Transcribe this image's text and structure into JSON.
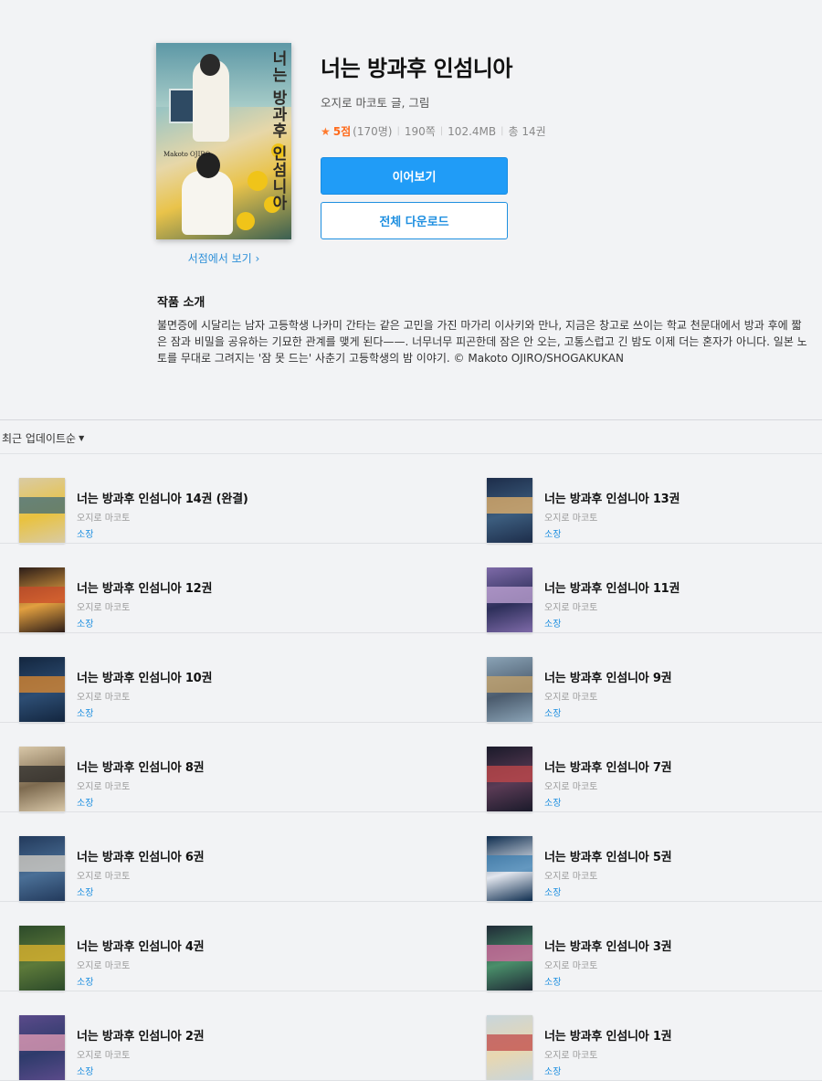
{
  "book": {
    "title": "너는 방과후 인섬니아",
    "author_line": "오지로 마코토 글, 그림",
    "rating": "5점",
    "rating_count": "(170명)",
    "pages": "190쪽",
    "size": "102.4MB",
    "volumes": "총 14권",
    "cover_title": "너는 방과후 인섬니아",
    "cover_author": "Makoto OJIRO",
    "store_link": "서점에서 보기 ›"
  },
  "actions": {
    "continue_label": "이어보기",
    "download_all_label": "전체 다운로드"
  },
  "intro": {
    "heading": "작품 소개",
    "text": "불면증에 시달리는 남자 고등학생 나카미 간타는 같은 고민을 가진 마가리 이사키와 만나, 지금은 창고로 쓰이는 학교 천문대에서 방과 후에 짧은 잠과 비밀을 공유하는 기묘한 관계를 맺게 된다——. 너무너무 피곤한데 잠은 안 오는, 고통스럽고 긴 밤도 이제 더는 혼자가 아니다. 일본 노토를 무대로 그려지는 '잠 못 드는' 사춘기 고등학생의 밤 이야기. © Makoto OJIRO/SHOGAKUKAN"
  },
  "sort": {
    "label": "최근 업데이트순"
  },
  "volumes": [
    {
      "title": "너는 방과후 인섬니아 14권 (완결)",
      "author": "오지로 마코토",
      "status": "소장",
      "colors": [
        "#d9cba4",
        "#3f6b7a",
        "#e9c23f"
      ]
    },
    {
      "title": "너는 방과후 인섬니아 13권",
      "author": "오지로 마코토",
      "status": "소장",
      "colors": [
        "#1d2d4a",
        "#e8b36a",
        "#3c5d7e"
      ]
    },
    {
      "title": "너는 방과후 인섬니아 12권",
      "author": "오지로 마코토",
      "status": "소장",
      "colors": [
        "#2c1d18",
        "#c94a2a",
        "#e2a040"
      ]
    },
    {
      "title": "너는 방과후 인섬니아 11권",
      "author": "오지로 마코토",
      "status": "소장",
      "colors": [
        "#7e6aa8",
        "#c4a7d8",
        "#2d2f5a"
      ]
    },
    {
      "title": "너는 방과후 인섬니아 10권",
      "author": "오지로 마코토",
      "status": "소장",
      "colors": [
        "#13263f",
        "#e08a2e",
        "#2d4d73"
      ]
    },
    {
      "title": "너는 방과후 인섬니아 9권",
      "author": "오지로 마코토",
      "status": "소장",
      "colors": [
        "#8aa3b6",
        "#c9a56b",
        "#4b5b6d"
      ]
    },
    {
      "title": "너는 방과후 인섬니아 8권",
      "author": "오지로 마코토",
      "status": "소장",
      "colors": [
        "#d8c7a8",
        "#2a2a2a",
        "#7d6a4f"
      ]
    },
    {
      "title": "너는 방과후 인섬니아 7권",
      "author": "오지로 마코토",
      "status": "소장",
      "colors": [
        "#1a1a2a",
        "#c4484a",
        "#5a3b55"
      ]
    },
    {
      "title": "너는 방과후 인섬니아 6권",
      "author": "오지로 마코토",
      "status": "소장",
      "colors": [
        "#233a5c",
        "#d9d2c6",
        "#4a6f96"
      ]
    },
    {
      "title": "너는 방과후 인섬니아 5권",
      "author": "오지로 마코토",
      "status": "소장",
      "colors": [
        "#0e2d4f",
        "#3a7db0",
        "#e2e6ee"
      ]
    },
    {
      "title": "너는 방과후 인섬니아 4권",
      "author": "오지로 마코토",
      "status": "소장",
      "colors": [
        "#2c4a2a",
        "#e2b52e",
        "#5d7a3a"
      ]
    },
    {
      "title": "너는 방과후 인섬니아 3권",
      "author": "오지로 마코토",
      "status": "소장",
      "colors": [
        "#1f2a36",
        "#d86aa0",
        "#4a8f6a"
      ]
    },
    {
      "title": "너는 방과후 인섬니아 2권",
      "author": "오지로 마코토",
      "status": "소장",
      "colors": [
        "#5a4a8a",
        "#e9a0b8",
        "#2e3b6b"
      ]
    },
    {
      "title": "너는 방과후 인섬니아 1권",
      "author": "오지로 마코토",
      "status": "소장",
      "colors": [
        "#c8d6dc",
        "#c0494a",
        "#e8d7b0"
      ]
    }
  ]
}
